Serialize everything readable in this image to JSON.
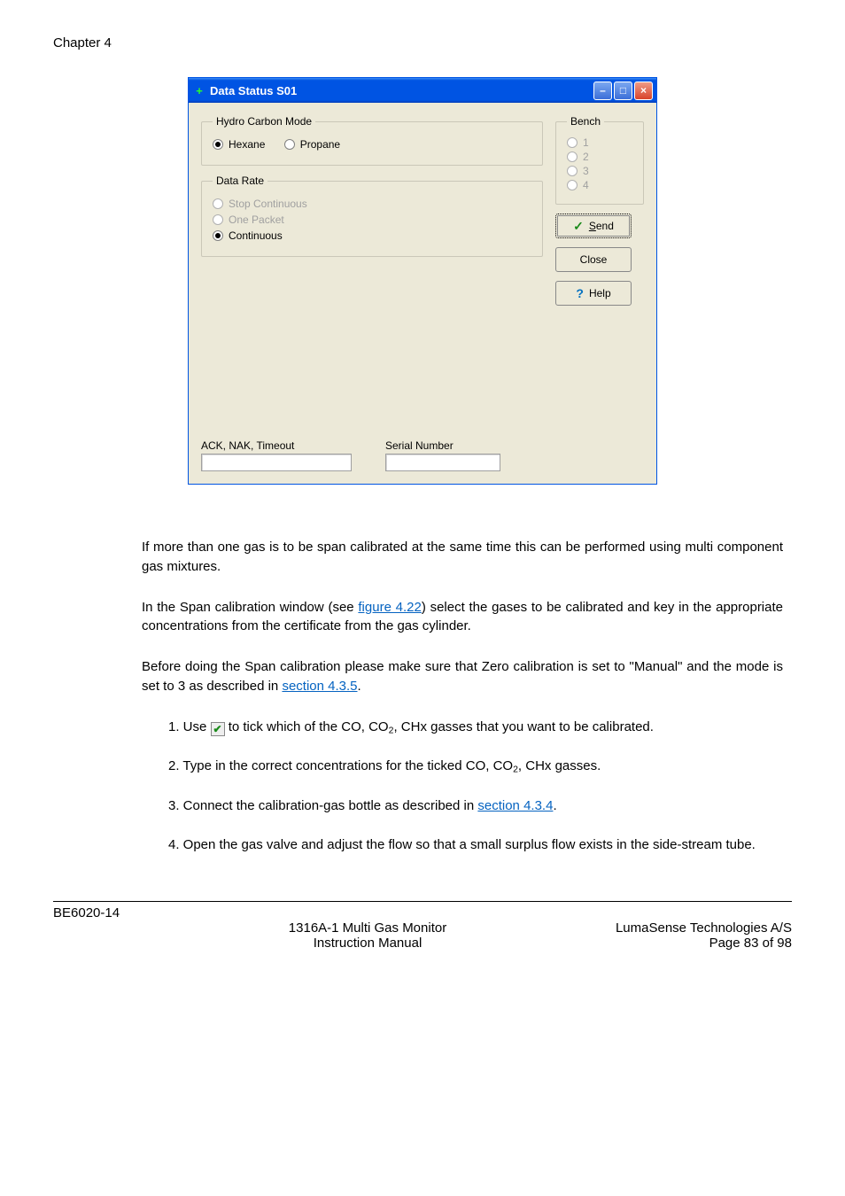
{
  "header": {
    "chapter": "Chapter 4"
  },
  "dialog": {
    "title": "Data Status S01",
    "icon_name": "plus-icon",
    "hydro_group": {
      "legend": "Hydro Carbon Mode",
      "hexane": "Hexane",
      "propane": "Propane"
    },
    "datarate_group": {
      "legend": "Data Rate",
      "stop": "Stop Continuous",
      "one": "One Packet",
      "cont": "Continuous"
    },
    "bench_group": {
      "legend": "Bench",
      "b1": "1",
      "b2": "2",
      "b3": "3",
      "b4": "4"
    },
    "buttons": {
      "send": "Send",
      "close": "Close",
      "help": "Help"
    },
    "ack_label": "ACK, NAK, Timeout",
    "serial_label": "Serial Number"
  },
  "paras": {
    "p1": "If more than one gas is to be span calibrated at the same time this can be performed using multi component gas mixtures.",
    "p2a": "In the Span calibration window (see ",
    "p2link": "figure 4.22",
    "p2b": ") select the gases to be calibrated and key in the appropriate concentrations from the certificate from the gas cylinder.",
    "p3a": "Before doing the Span calibration please make sure that Zero calibration is set to \"Manual\" and the mode is set to 3 as described in ",
    "p3link": "section 4.3.5",
    "p3b": ".",
    "l1a": "1. Use ",
    "l1b": " to tick which of the CO, CO",
    "l1c": ", CHx gasses that you want to be calibrated.",
    "l2a": "2. Type in the correct concentrations for the ticked CO, CO",
    "l2b": ", CHx gasses.",
    "l3a": "3. Connect the calibration-gas bottle as described in ",
    "l3link": "section 4.3.4",
    "l3b": ".",
    "l4": "4. Open the gas valve and adjust the flow so that a small surplus flow exists in the side-stream tube."
  },
  "footer": {
    "left": "BE6020-14",
    "center1": "1316A-1 Multi Gas Monitor",
    "center2": "Instruction Manual",
    "right1": "LumaSense Technologies A/S",
    "right2": "Page 83 of 98"
  }
}
